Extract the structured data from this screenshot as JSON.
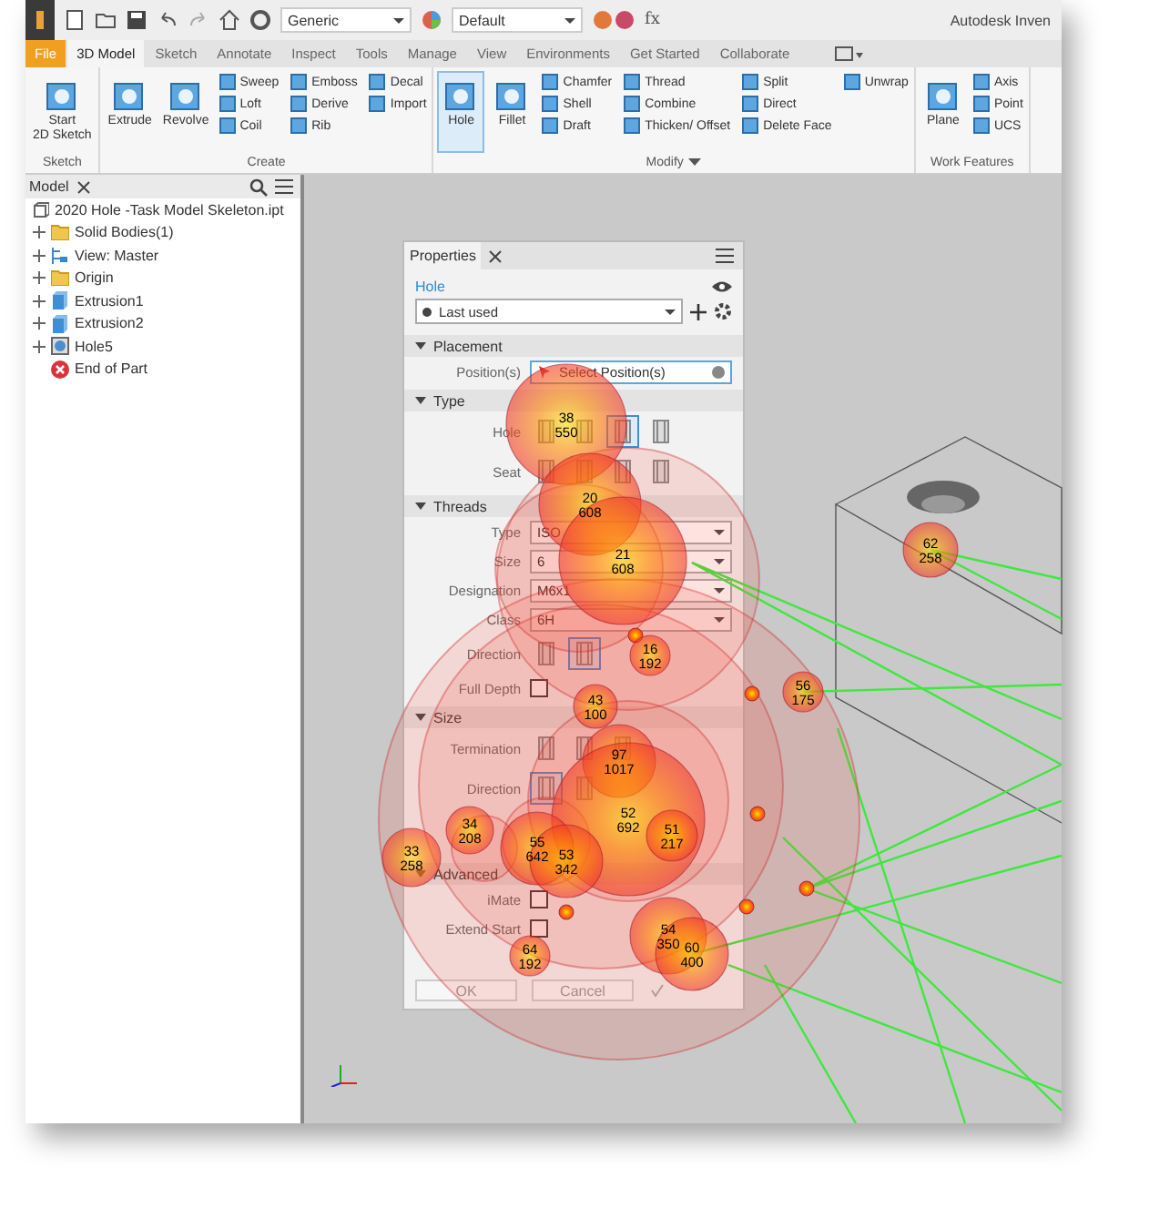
{
  "quick_access": {
    "material": "Generic",
    "appearance": "Default",
    "app_title": "Autodesk Inven",
    "formula": "fx"
  },
  "tabs": [
    {
      "label": "File",
      "kind": "file",
      "selected": false
    },
    {
      "label": "3D Model",
      "kind": "tab",
      "selected": true
    },
    {
      "label": "Sketch",
      "kind": "tab",
      "selected": false
    },
    {
      "label": "Annotate",
      "kind": "tab",
      "selected": false
    },
    {
      "label": "Inspect",
      "kind": "tab",
      "selected": false
    },
    {
      "label": "Tools",
      "kind": "tab",
      "selected": false
    },
    {
      "label": "Manage",
      "kind": "tab",
      "selected": false
    },
    {
      "label": "View",
      "kind": "tab",
      "selected": false
    },
    {
      "label": "Environments",
      "kind": "tab",
      "selected": false
    },
    {
      "label": "Get Started",
      "kind": "tab",
      "selected": false
    },
    {
      "label": "Collaborate",
      "kind": "tab",
      "selected": false
    }
  ],
  "ribbon": [
    {
      "label": "Sketch",
      "menu": false,
      "tools": [
        {
          "label": "Start\n2D Sketch",
          "kind": "large",
          "selected": false
        }
      ]
    },
    {
      "label": "Create",
      "menu": false,
      "tools": [
        {
          "label": "Extrude",
          "kind": "large",
          "selected": false
        },
        {
          "label": "Revolve",
          "kind": "large",
          "selected": false
        },
        {
          "label": "Sweep",
          "kind": "small",
          "selected": false
        },
        {
          "label": "Loft",
          "kind": "small",
          "selected": false
        },
        {
          "label": "Coil",
          "kind": "small",
          "selected": false
        },
        {
          "label": "Emboss",
          "kind": "small",
          "selected": false
        },
        {
          "label": "Derive",
          "kind": "small",
          "selected": false
        },
        {
          "label": "Rib",
          "kind": "small",
          "selected": false
        },
        {
          "label": "Decal",
          "kind": "small",
          "selected": false
        },
        {
          "label": "Import",
          "kind": "small",
          "selected": false
        }
      ]
    },
    {
      "label": "Modify",
      "menu": true,
      "tools": [
        {
          "label": "Hole",
          "kind": "large",
          "selected": true
        },
        {
          "label": "Fillet",
          "kind": "large",
          "selected": false
        },
        {
          "label": "Chamfer",
          "kind": "small",
          "selected": false
        },
        {
          "label": "Shell",
          "kind": "small",
          "selected": false
        },
        {
          "label": "Draft",
          "kind": "small",
          "selected": false
        },
        {
          "label": "Thread",
          "kind": "small",
          "selected": false
        },
        {
          "label": "Combine",
          "kind": "small",
          "selected": false
        },
        {
          "label": "Thicken/ Offset",
          "kind": "small",
          "selected": false
        },
        {
          "label": "Split",
          "kind": "small",
          "selected": false
        },
        {
          "label": "Direct",
          "kind": "small",
          "selected": false
        },
        {
          "label": "Delete Face",
          "kind": "small",
          "selected": false
        },
        {
          "label": "Unwrap",
          "kind": "small",
          "selected": false
        }
      ]
    },
    {
      "label": "Work Features",
      "menu": false,
      "tools": [
        {
          "label": "Plane",
          "kind": "large",
          "selected": false
        },
        {
          "label": "Axis",
          "kind": "small",
          "selected": false
        },
        {
          "label": "Point",
          "kind": "small",
          "selected": false
        },
        {
          "label": "UCS",
          "kind": "small",
          "selected": false
        }
      ]
    }
  ],
  "browser": {
    "tab": "Model",
    "tree": {
      "label": "2020 Hole -Task Model Skeleton.ipt",
      "kind": "part",
      "children": [
        {
          "label": "Solid Bodies(1)",
          "kind": "folder",
          "expanded": false
        },
        {
          "label": "View: Master",
          "kind": "view",
          "expanded": false
        },
        {
          "label": "Origin",
          "kind": "folder",
          "expanded": false
        },
        {
          "label": "Extrusion1",
          "kind": "body",
          "expanded": false
        },
        {
          "label": "Extrusion2",
          "kind": "body",
          "expanded": false
        },
        {
          "label": "Hole5",
          "kind": "hole",
          "expanded": false
        },
        {
          "label": "End of Part",
          "kind": "end"
        }
      ]
    }
  },
  "properties": {
    "tab": "Properties",
    "title": "Hole",
    "preset": "Last used",
    "sections": [
      {
        "title": "Placement",
        "expanded": true,
        "rows": [
          {
            "kind": "select",
            "label": "Position(s)",
            "value": "Select Position(s)"
          }
        ]
      },
      {
        "title": "Type",
        "expanded": true,
        "rows": [
          {
            "kind": "icons",
            "label": "Hole",
            "options": [
              {
                "selected": false
              },
              {
                "selected": false
              },
              {
                "selected": true
              },
              {
                "selected": false
              }
            ]
          },
          {
            "kind": "icons",
            "label": "Seat",
            "options": [
              {
                "selected": false
              },
              {
                "selected": false
              },
              {
                "selected": false
              },
              {
                "selected": false
              }
            ]
          }
        ]
      },
      {
        "title": "Threads",
        "expanded": true,
        "rows": [
          {
            "kind": "dropdown",
            "label": "Type",
            "value": "ISO"
          },
          {
            "kind": "dropdown",
            "label": "Size",
            "value": "6"
          },
          {
            "kind": "dropdown",
            "label": "Designation",
            "value": "M6x1"
          },
          {
            "kind": "dropdown",
            "label": "Class",
            "value": "6H"
          },
          {
            "kind": "icons",
            "label": "Direction",
            "options": [
              {
                "selected": false
              },
              {
                "selected": true
              }
            ]
          },
          {
            "kind": "checkbox",
            "label": "Full Depth",
            "checked": false
          }
        ]
      },
      {
        "title": "Size",
        "expanded": true,
        "rows": [
          {
            "kind": "icons",
            "label": "Termination",
            "options": [
              {
                "selected": false
              },
              {
                "selected": false
              },
              {
                "selected": false
              }
            ]
          },
          {
            "kind": "icons",
            "label": "Direction",
            "options": [
              {
                "selected": true
              },
              {
                "selected": false
              }
            ]
          }
        ]
      },
      {
        "title": "Advanced",
        "expanded": true,
        "rows": [
          {
            "kind": "checkbox",
            "label": "iMate",
            "checked": false
          },
          {
            "kind": "checkbox",
            "label": "Extend Start",
            "checked": false
          }
        ]
      }
    ],
    "buttons": [
      "OK",
      "Cancel"
    ]
  },
  "fixations": [
    {
      "number": "38",
      "duration": "550"
    },
    {
      "number": "20",
      "duration": "608"
    },
    {
      "number": "21",
      "duration": "608"
    },
    {
      "number": "56",
      "duration": "175"
    },
    {
      "number": "62",
      "duration": "258"
    },
    {
      "number": "16",
      "duration": "192"
    },
    {
      "number": "43",
      "duration": "100"
    },
    {
      "number": "97",
      "duration": "1017"
    },
    {
      "number": "52",
      "duration": "692"
    },
    {
      "number": "51",
      "duration": "217"
    },
    {
      "number": "34",
      "duration": "208"
    },
    {
      "number": "33",
      "duration": "258"
    },
    {
      "number": "55",
      "duration": "642"
    },
    {
      "number": "53",
      "duration": "342"
    },
    {
      "number": "54",
      "duration": "350"
    },
    {
      "number": "60",
      "duration": "400"
    },
    {
      "number": "64",
      "duration": "192"
    }
  ]
}
